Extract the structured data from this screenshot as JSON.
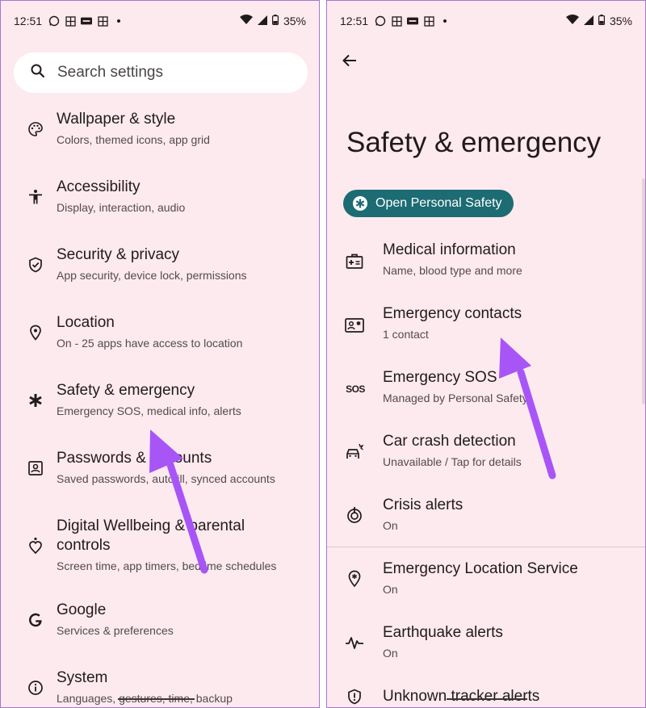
{
  "left": {
    "status": {
      "time": "12:51",
      "battery": "35%"
    },
    "search": {
      "placeholder": "Search settings"
    },
    "items": [
      {
        "title": "Wallpaper & style",
        "sub": "Colors, themed icons, app grid",
        "icon": "palette-icon"
      },
      {
        "title": "Accessibility",
        "sub": "Display, interaction, audio",
        "icon": "accessibility-icon"
      },
      {
        "title": "Security & privacy",
        "sub": "App security, device lock, permissions",
        "icon": "shield-icon"
      },
      {
        "title": "Location",
        "sub": "On - 25 apps have access to location",
        "icon": "location-pin-icon"
      },
      {
        "title": "Safety & emergency",
        "sub": "Emergency SOS, medical info, alerts",
        "icon": "asterisk-icon"
      },
      {
        "title": "Passwords & accounts",
        "sub": "Saved passwords, autofill, synced accounts",
        "icon": "account-box-icon"
      },
      {
        "title": "Digital Wellbeing & parental",
        "title2": "controls",
        "sub": "Screen time, app timers, bedtime schedules",
        "icon": "wellbeing-icon"
      },
      {
        "title": "Google",
        "sub": "Services & preferences",
        "icon": "google-icon"
      },
      {
        "title": "System",
        "sub": "Languages, gestures, time, backup",
        "icon": "info-icon"
      }
    ]
  },
  "right": {
    "status": {
      "time": "12:51",
      "battery": "35%"
    },
    "title": "Safety & emergency",
    "chip": {
      "label": "Open Personal Safety"
    },
    "items": [
      {
        "title": "Medical information",
        "sub": "Name, blood type and more",
        "icon": "medical-id-icon"
      },
      {
        "title": "Emergency contacts",
        "sub": "1 contact",
        "icon": "contact-card-icon"
      },
      {
        "title": "Emergency SOS",
        "sub": "Managed by Personal Safety",
        "icon": "sos-icon",
        "icon_text": "SOS"
      },
      {
        "title": "Car crash detection",
        "sub": "Unavailable / Tap for details",
        "icon": "car-crash-icon"
      },
      {
        "title": "Crisis alerts",
        "sub": "On",
        "icon": "crisis-alert-icon"
      },
      {
        "title": "Emergency Location Service",
        "sub": "On",
        "icon": "location-star-icon"
      },
      {
        "title": "Earthquake alerts",
        "sub": "On",
        "icon": "earthquake-icon"
      },
      {
        "title": "Unknown tracker alerts",
        "icon": "tracker-shield-icon"
      }
    ]
  },
  "colors": {
    "panel_bg": "#fdeaee",
    "accent_chip": "#1d6b73",
    "arrow": "#a855f7",
    "border": "#a675d3"
  }
}
